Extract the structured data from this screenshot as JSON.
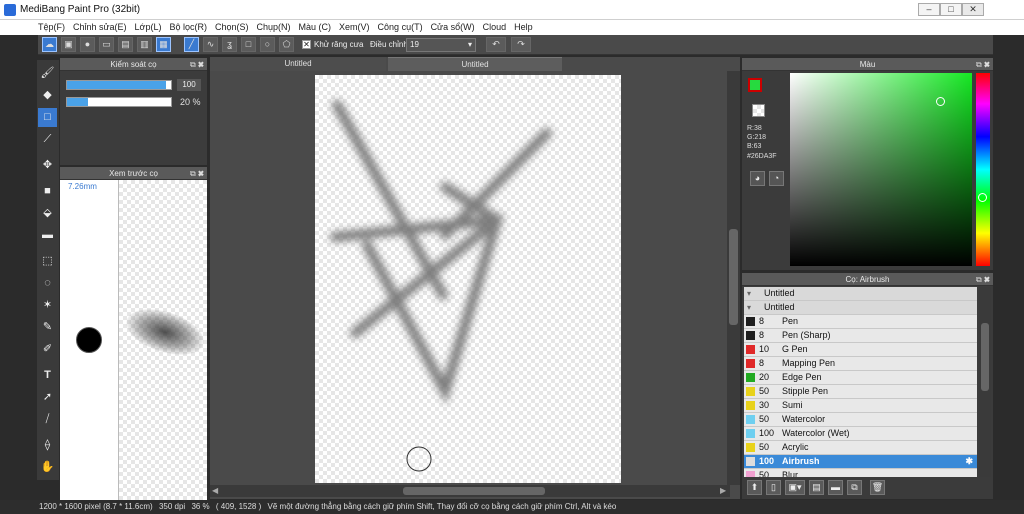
{
  "window": {
    "title": "MediBang Paint Pro (32bit)",
    "controls": [
      "–",
      "□",
      "✕"
    ],
    "inner_controls": [
      "–",
      "□",
      "✕"
    ]
  },
  "menu": [
    "Tệp(F)",
    "Chỉnh sửa(E)",
    "Lớp(L)",
    "Bộ lọc(R)",
    "Chọn(S)",
    "Chụp(N)",
    "Màu (C)",
    "Xem(V)",
    "Công cụ(T)",
    "Cửa sổ(W)",
    "Cloud",
    "Help"
  ],
  "toolbar": {
    "antialias_label": "Khử răng cưa",
    "adjust_label": "Điều chỉnh",
    "adjust_value": "19"
  },
  "brush_control": {
    "title": "Kiểm soát cọ",
    "size_value": "100",
    "size_fill": 0.95,
    "opacity_value": "20 %",
    "opacity_fill": 0.2
  },
  "brush_preview": {
    "title": "Xem trước cọ",
    "size_label": "7.26mm"
  },
  "document": {
    "tabs": [
      "Untitled",
      "Untitled"
    ]
  },
  "color_panel": {
    "title": "Màu",
    "rgb_r": "R:38",
    "rgb_g": "G:218",
    "rgb_b": "B:63",
    "hex": "#26DA3F",
    "current_color": "#26DA3F"
  },
  "brush_list": {
    "title": "Cọ: Airbrush",
    "groups": [
      "Untitled",
      "Untitled"
    ],
    "items": [
      {
        "size": "8",
        "name": "Pen",
        "color": "#1e1e1e"
      },
      {
        "size": "8",
        "name": "Pen (Sharp)",
        "color": "#1e1e1e"
      },
      {
        "size": "10",
        "name": "G Pen",
        "color": "#e02828"
      },
      {
        "size": "8",
        "name": "Mapping Pen",
        "color": "#e02828"
      },
      {
        "size": "20",
        "name": "Edge Pen",
        "color": "#22aa22"
      },
      {
        "size": "50",
        "name": "Stipple Pen",
        "color": "#e8d21a"
      },
      {
        "size": "30",
        "name": "Sumi",
        "color": "#e8d21a"
      },
      {
        "size": "50",
        "name": "Watercolor",
        "color": "#6ecff0"
      },
      {
        "size": "100",
        "name": "Watercolor (Wet)",
        "color": "#6ecff0"
      },
      {
        "size": "50",
        "name": "Acrylic",
        "color": "#e8d21a"
      },
      {
        "size": "100",
        "name": "Airbrush",
        "color": "#dddddd"
      },
      {
        "size": "50",
        "name": "Blur",
        "color": "#f0a0d0"
      }
    ]
  },
  "status": {
    "dimensions": "1200 * 1600 pixel",
    "physical": "(8.7 * 11.6cm)",
    "dpi": "350 dpi",
    "zoom": "36 %",
    "cursor": "( 409, 1528 )",
    "hint": "Vẽ một đường thẳng bằng cách giữ phím Shift, Thay đổi cỡ cọ bằng cách giữ phím Ctrl, Alt và kéo"
  }
}
